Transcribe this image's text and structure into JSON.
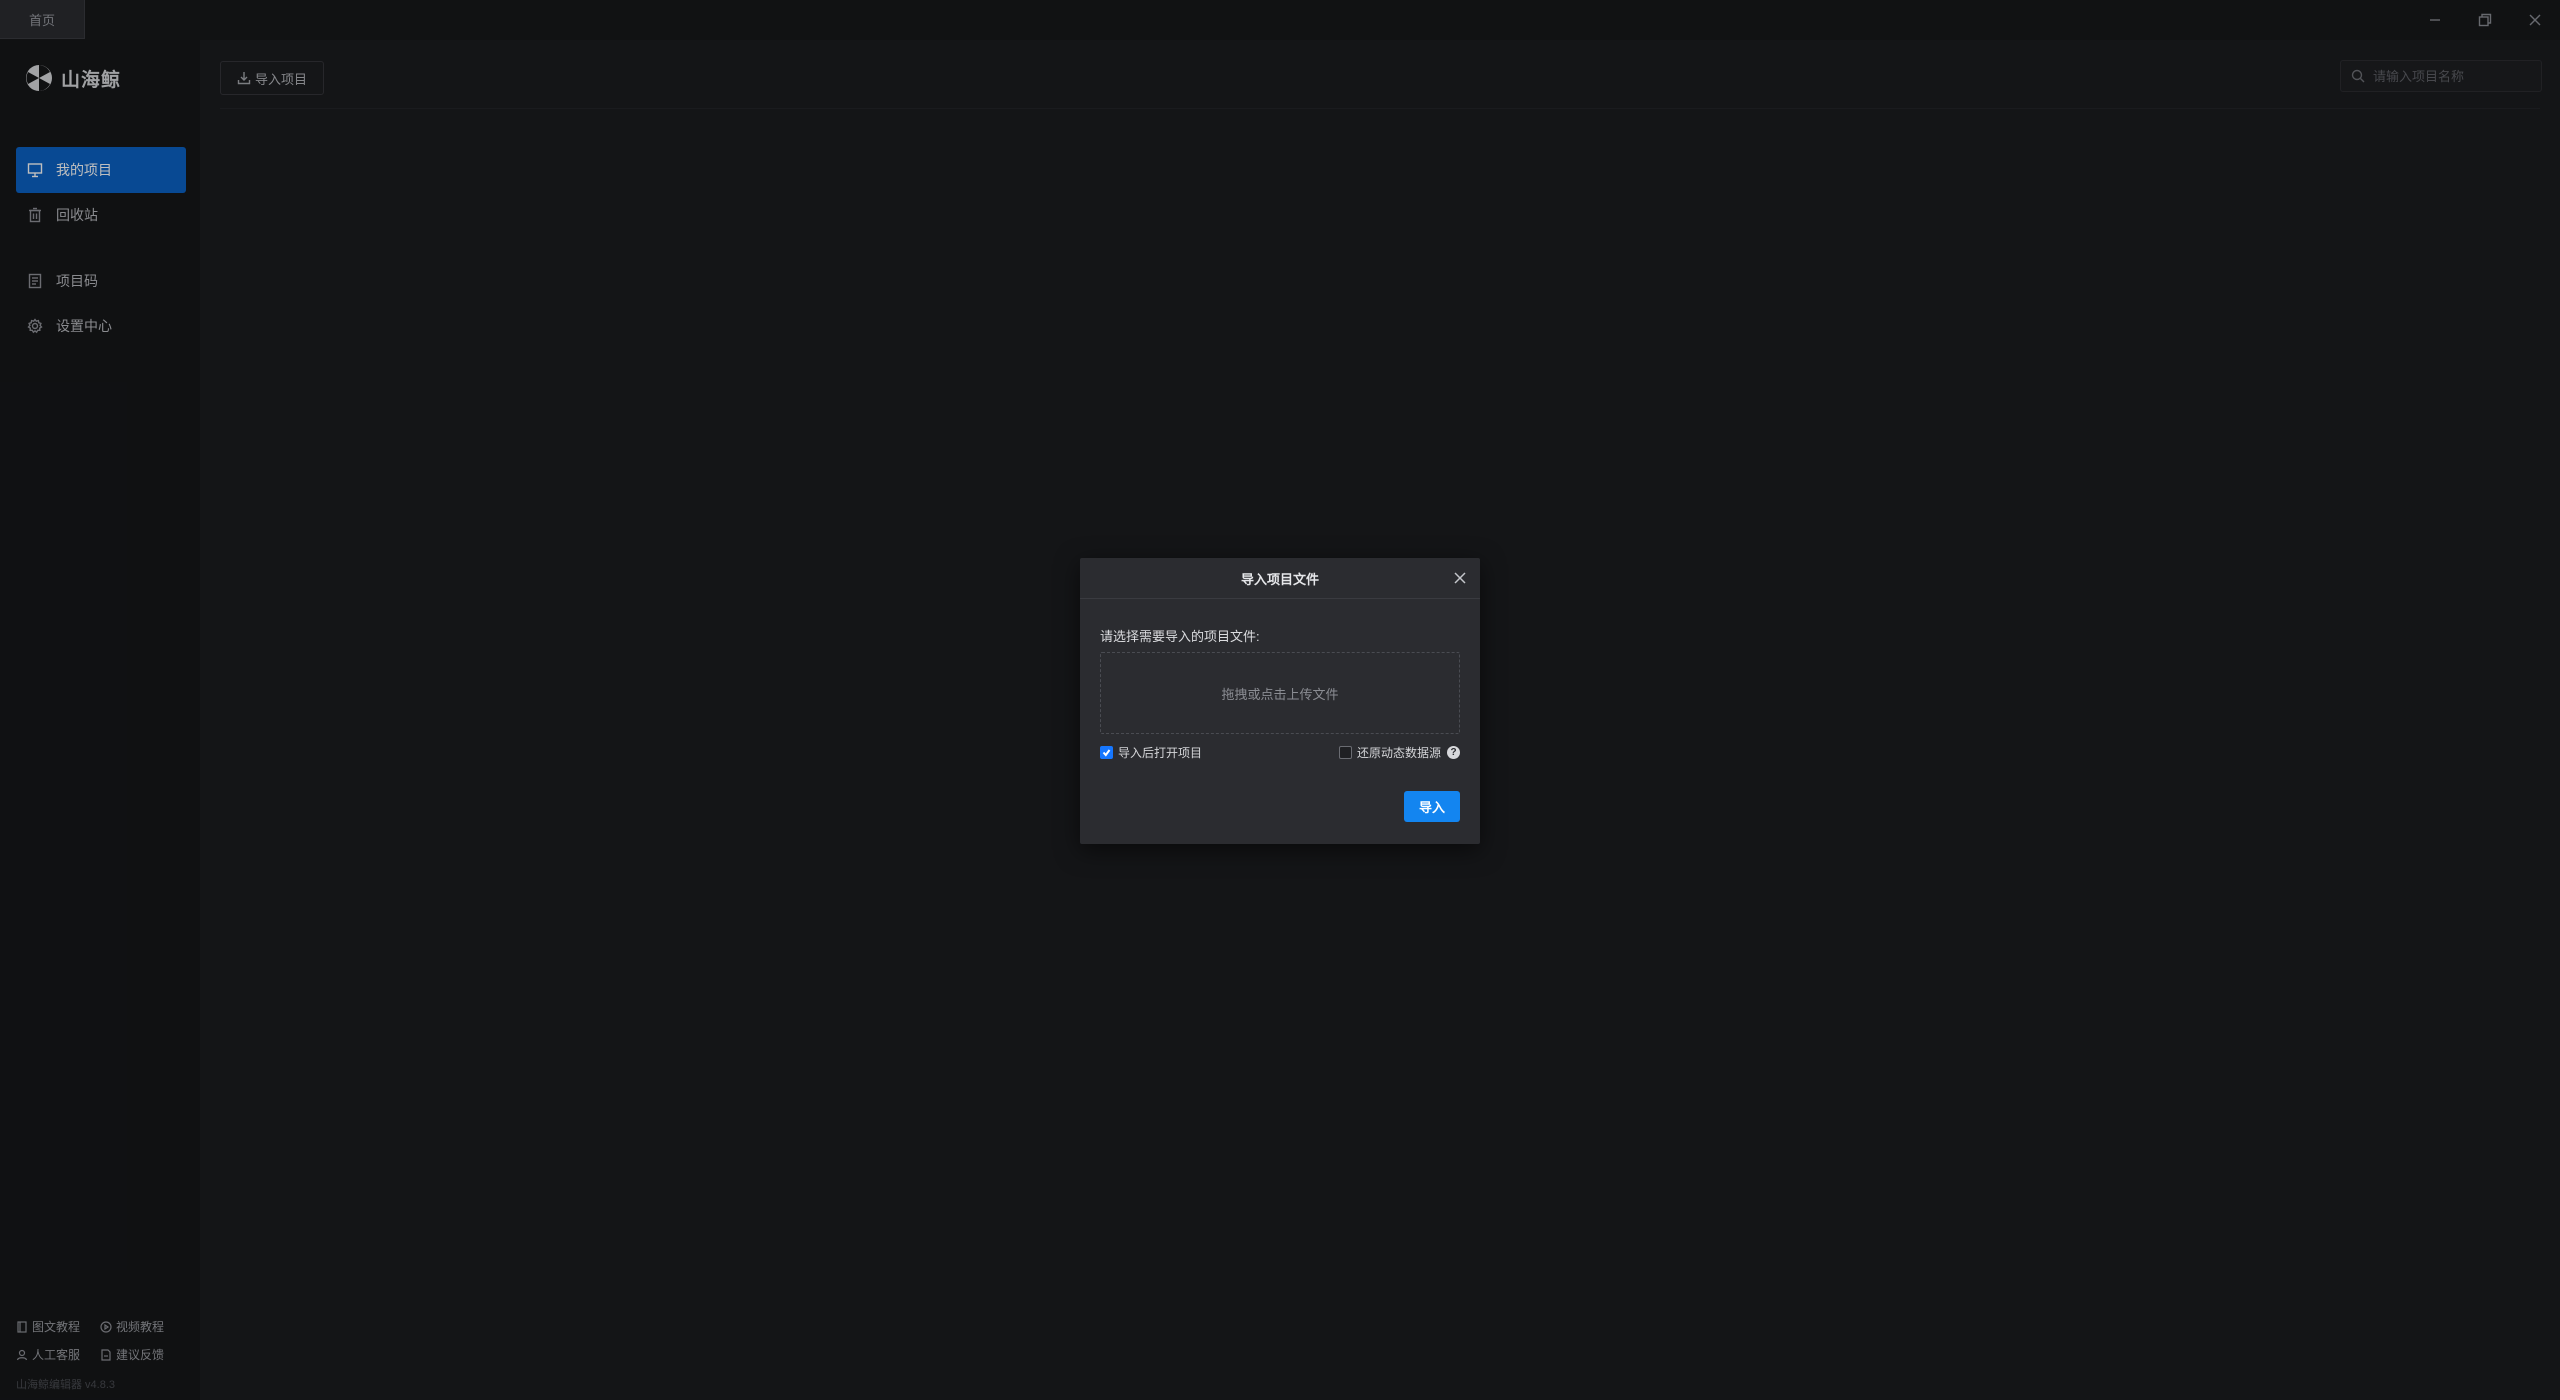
{
  "titlebar": {
    "tab_label": "首页"
  },
  "sidebar": {
    "logo_text": "山海鲸",
    "items": [
      {
        "label": "我的项目",
        "icon": "presentation-icon",
        "active": true
      },
      {
        "label": "回收站",
        "icon": "trash-icon",
        "active": false
      },
      {
        "label": "项目码",
        "icon": "document-icon",
        "active": false
      },
      {
        "label": "设置中心",
        "icon": "gear-icon",
        "active": false
      }
    ],
    "footer_links": [
      {
        "label": "图文教程",
        "icon": "book-icon"
      },
      {
        "label": "视频教程",
        "icon": "play-circle-icon"
      },
      {
        "label": "人工客服",
        "icon": "user-icon"
      },
      {
        "label": "建议反馈",
        "icon": "edit-icon"
      }
    ],
    "version": "山海鲸编辑器 v4.8.3"
  },
  "toolbar": {
    "import_label": "导入项目",
    "search_placeholder": "请输入项目名称"
  },
  "modal": {
    "title": "导入项目文件",
    "prompt": "请选择需要导入的项目文件:",
    "dropzone_text": "拖拽或点击上传文件",
    "open_after_import": {
      "label": "导入后打开项目",
      "checked": true
    },
    "restore_datasource": {
      "label": "还原动态数据源",
      "checked": false
    },
    "help_symbol": "?",
    "confirm_label": "导入"
  },
  "colors": {
    "accent": "#0b62c4",
    "button_primary": "#1385f0",
    "background": "#1b1c1f",
    "sidebar": "#161719",
    "modal": "#2b2c30"
  }
}
